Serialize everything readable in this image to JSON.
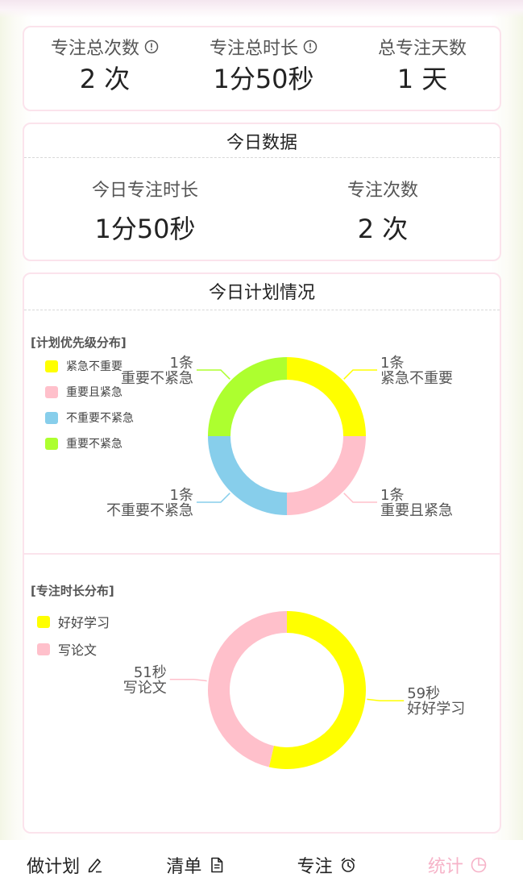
{
  "summary": {
    "total_count_label": "专注总次数",
    "total_count_value": "2 次",
    "total_time_label": "专注总时长",
    "total_time_value": "1分50秒",
    "total_days_label": "总专注天数",
    "total_days_value": "1 天"
  },
  "today": {
    "title": "今日数据",
    "focus_time_label": "今日专注时长",
    "focus_time_value": "1分50秒",
    "focus_count_label": "专注次数",
    "focus_count_value": "2 次"
  },
  "plan": {
    "title": "今日计划情况"
  },
  "colors": {
    "accent_pink": "#f6b3c8",
    "card_border": "#fbe3ec",
    "yellow": "#ffff00",
    "pink": "#ffc0cb",
    "sky_blue": "#87ceeb",
    "green_yellow": "#adff2f"
  },
  "chart_data": [
    {
      "type": "pie",
      "title": "[计划优先级分布]",
      "legend_position": "top-left",
      "slices": [
        {
          "name": "紧急不重要",
          "value": 1,
          "label": "1条",
          "color": "#ffff00"
        },
        {
          "name": "重要且紧急",
          "value": 1,
          "label": "1条",
          "color": "#ffc0cb"
        },
        {
          "name": "不重要不紧急",
          "value": 1,
          "label": "1条",
          "color": "#87ceeb"
        },
        {
          "name": "重要不紧急",
          "value": 1,
          "label": "1条",
          "color": "#adff2f"
        }
      ]
    },
    {
      "type": "pie",
      "title": "[专注时长分布]",
      "legend_position": "top-left",
      "slices": [
        {
          "name": "好好学习",
          "value": 59,
          "label": "59秒",
          "color": "#ffff00"
        },
        {
          "name": "写论文",
          "value": 51,
          "label": "51秒",
          "color": "#ffc0cb"
        }
      ]
    }
  ],
  "nav": {
    "items": [
      {
        "label": "做计划",
        "icon": "pencil-icon"
      },
      {
        "label": "清单",
        "icon": "document-icon"
      },
      {
        "label": "专注",
        "icon": "alarm-clock-icon"
      },
      {
        "label": "统计",
        "icon": "pie-chart-icon"
      }
    ],
    "active_index": 3
  }
}
